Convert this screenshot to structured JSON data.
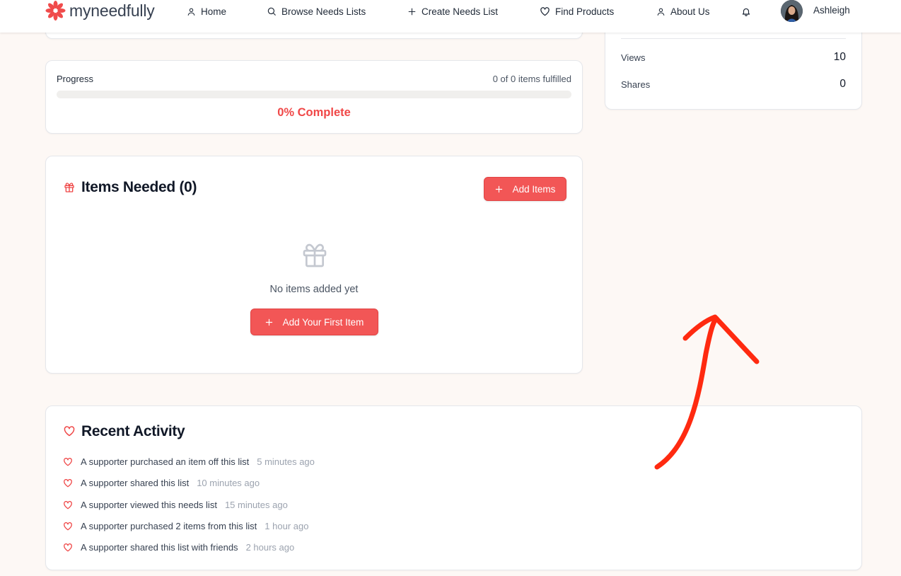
{
  "brand": {
    "name": "myneedfully",
    "accent_color": "#f04747"
  },
  "nav": {
    "items": [
      {
        "label": "Home",
        "icon": "user-icon"
      },
      {
        "label": "Browse Needs Lists",
        "icon": "search-icon"
      },
      {
        "label": "Create Needs List",
        "icon": "plus-icon"
      },
      {
        "label": "Find Products",
        "icon": "heart-icon"
      },
      {
        "label": "About Us",
        "icon": "user-icon"
      }
    ],
    "notifications_icon": "bell-icon",
    "user_name": "Ashleigh"
  },
  "stats": {
    "views_label": "Views",
    "views_value": "10",
    "shares_label": "Shares",
    "shares_value": "0"
  },
  "progress": {
    "label": "Progress",
    "count_text": "0 of 0 items fulfilled",
    "fraction": 0,
    "percent_text": "0% Complete"
  },
  "items_needed": {
    "icon": "gift-icon",
    "title": "Items Needed (0)",
    "add_button": "Add Items",
    "empty_text": "No items added yet",
    "first_item_button": "Add Your First Item"
  },
  "recent_activity": {
    "icon": "heart-icon",
    "title": "Recent Activity",
    "items": [
      {
        "text": "A supporter purchased an item off this list",
        "time": "5 minutes ago"
      },
      {
        "text": "A supporter shared this list",
        "time": "10 minutes ago"
      },
      {
        "text": "A supporter viewed this needs list",
        "time": "15 minutes ago"
      },
      {
        "text": "A supporter purchased 2 items from this list",
        "time": "1 hour ago"
      },
      {
        "text": "A supporter shared this list with friends",
        "time": "2 hours ago"
      }
    ]
  },
  "annotation": {
    "type": "hand-drawn-arrow",
    "color": "#ff2a10"
  }
}
